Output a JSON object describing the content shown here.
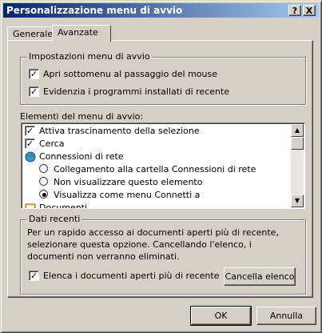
{
  "window": {
    "title": "Personalizzazione menu di avvio",
    "help_glyph": "?",
    "close_glyph": "X"
  },
  "tabs": [
    {
      "label": "Generale"
    },
    {
      "label": "Avanzate"
    }
  ],
  "settings_group": {
    "title": "Impostazioni menu di avvio",
    "options": [
      {
        "label": "Apri sottomenu al passaggio del mouse",
        "checked": true
      },
      {
        "label": "Evidenzia i programmi installati di recente",
        "checked": true
      }
    ]
  },
  "items_section": {
    "title": "Elementi del menu di avvio:",
    "items": [
      {
        "kind": "check",
        "label": "Attiva trascinamento della selezione",
        "checked": true
      },
      {
        "kind": "check",
        "label": "Cerca",
        "checked": true
      },
      {
        "kind": "icon",
        "icon": "network-icon",
        "label": "Connessioni di rete"
      },
      {
        "kind": "radio",
        "label": "Collegamento alla cartella Connessioni di rete",
        "selected": false
      },
      {
        "kind": "radio",
        "label": "Non visualizzare questo elemento",
        "selected": false
      },
      {
        "kind": "radio",
        "label": "Visualizza come menu Connetti a",
        "selected": true
      },
      {
        "kind": "icon",
        "icon": "documents-icon",
        "label": "Documenti"
      }
    ]
  },
  "recent_group": {
    "title": "Dati recenti",
    "description": "Per un rapido accesso ai documenti aperti più di recente, selezionare questa opzione. Cancellando l'elenco, i documenti non verranno eliminati.",
    "checkbox": {
      "label": "Elenca i documenti aperti più di recente",
      "checked": true
    },
    "clear_button": "Cancella elenco"
  },
  "footer": {
    "ok": "OK",
    "cancel": "Annulla"
  }
}
